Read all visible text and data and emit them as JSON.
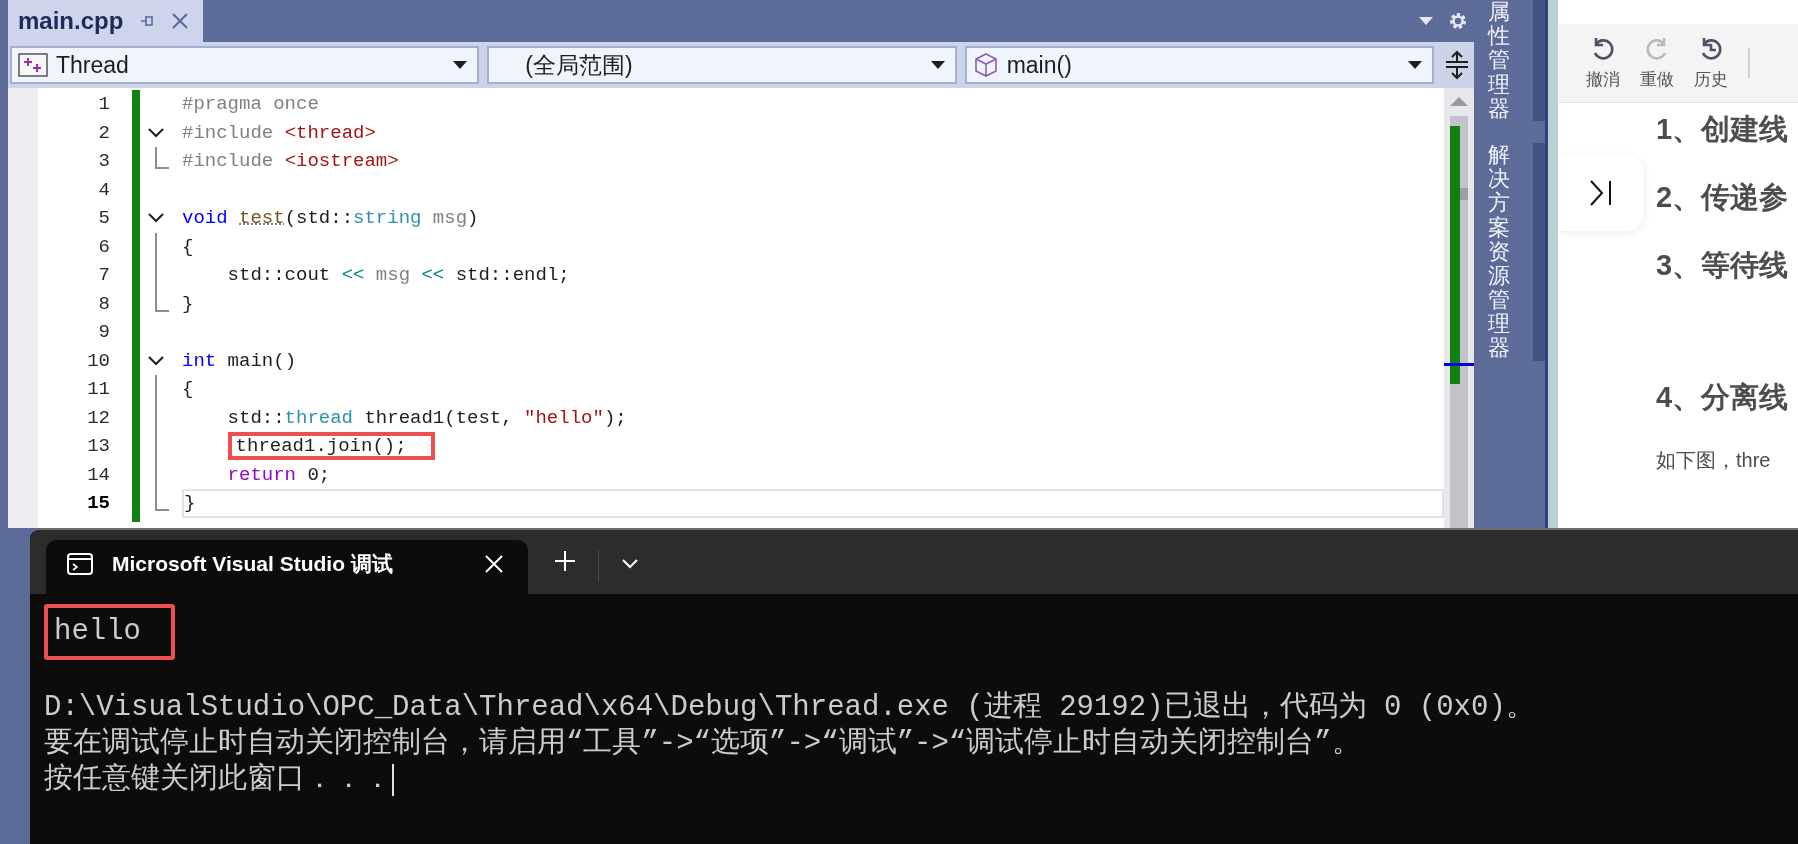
{
  "editor": {
    "tabs": [
      {
        "label": "main.cpp",
        "selected": true
      }
    ],
    "navigation": [
      {
        "kind": "project",
        "value": "Thread"
      },
      {
        "kind": "scope",
        "value": "(全局范围)"
      },
      {
        "kind": "member",
        "value": "main()"
      }
    ],
    "lines": [
      {
        "number": "1",
        "kind": "plain",
        "current": false,
        "tokens": [
          {
            "text": "#pragma once",
            "kind": "preproc"
          }
        ]
      },
      {
        "number": "2",
        "kind": "fold-start",
        "current": false,
        "tokens": [
          {
            "text": "#include ",
            "kind": "preproc"
          },
          {
            "text": "<thread>",
            "kind": "include"
          }
        ]
      },
      {
        "number": "3",
        "kind": "fold-end",
        "current": false,
        "tokens": [
          {
            "text": "#include ",
            "kind": "preproc"
          },
          {
            "text": "<iostream>",
            "kind": "include"
          }
        ]
      },
      {
        "number": "4",
        "kind": "plain",
        "current": false
      },
      {
        "number": "5",
        "kind": "fold-start",
        "current": false,
        "tokens": [
          {
            "text": "void ",
            "kind": "keyword"
          },
          {
            "text": "test",
            "kind": "func"
          },
          {
            "text": "(std::",
            "kind": "plain"
          },
          {
            "text": "string",
            "kind": "type"
          },
          {
            "text": " msg",
            "kind": "param"
          },
          {
            "text": ")",
            "kind": "plain"
          }
        ]
      },
      {
        "number": "6",
        "kind": "fold-body",
        "current": false,
        "tokens": [
          {
            "text": "{",
            "kind": "plain"
          }
        ],
        "children": [
          {
            "number": "7",
            "kind": "fold-body",
            "current": false,
            "tokens": [
              {
                "text": "std::cout ",
                "kind": "plain"
              },
              {
                "text": "<<",
                "kind": "operator"
              },
              {
                "text": " msg ",
                "kind": "param"
              },
              {
                "text": "<<",
                "kind": "operator"
              },
              {
                "text": " std::endl;",
                "kind": "plain"
              }
            ]
          }
        ]
      },
      {
        "number": "8",
        "kind": "fold-end",
        "current": false,
        "tokens": [
          {
            "text": "}",
            "kind": "plain"
          }
        ]
      },
      {
        "number": "9",
        "kind": "plain",
        "current": false
      },
      {
        "number": "10",
        "kind": "fold-start",
        "current": false,
        "tokens": [
          {
            "text": "int",
            "kind": "keyword"
          },
          {
            "text": " main()",
            "kind": "plain"
          }
        ]
      },
      {
        "number": "11",
        "kind": "fold-body",
        "current": false,
        "tokens": [
          {
            "text": "{",
            "kind": "plain"
          }
        ],
        "children": [
          {
            "number": "12",
            "kind": "fold-body",
            "current": false,
            "tokens": [
              {
                "text": "std::",
                "kind": "plain"
              },
              {
                "text": "thread",
                "kind": "type"
              },
              {
                "text": " thread1(test, ",
                "kind": "plain"
              },
              {
                "text": "\"hello\"",
                "kind": "string"
              },
              {
                "text": ");",
                "kind": "plain"
              }
            ]
          },
          {
            "number": "13",
            "kind": "fold-body",
            "current": false,
            "tokens": [
              {
                "text": "thread1.join();",
                "kind": "plain",
                "boxed": true
              }
            ]
          },
          {
            "number": "14",
            "kind": "fold-body",
            "current": false,
            "tokens": [
              {
                "text": "return",
                "kind": "control"
              },
              {
                "text": " 0;",
                "kind": "plain"
              }
            ]
          }
        ]
      },
      {
        "number": "15",
        "kind": "fold-end",
        "current": true,
        "tokens": [
          {
            "text": "}",
            "kind": "plain"
          }
        ]
      }
    ]
  },
  "side_tabs": [
    {
      "label": "属性管理器"
    },
    {
      "label": "解决方案资源管理器"
    }
  ],
  "web_panel": {
    "toolbar": [
      {
        "label": "撤消",
        "kind": "undo",
        "disabled": false
      },
      {
        "label": "重做",
        "kind": "redo",
        "disabled": true
      },
      {
        "label": "历史",
        "kind": "history",
        "disabled": false
      }
    ],
    "headings": [
      "1、创建线",
      "2、传递参",
      "3、等待线",
      "4、分离线"
    ],
    "paragraph": "如下图，thre"
  },
  "console": {
    "tab_title": "Microsoft Visual Studio 调试",
    "output": [
      {
        "text": "hello",
        "boxed": true,
        "blank_before": false,
        "cursor": false
      },
      {
        "text": "D:\\VisualStudio\\OPC_Data\\Thread\\x64\\Debug\\Thread.exe (进程 29192)已退出，代码为 0 (0x0)。",
        "boxed": false,
        "blank_before": true,
        "cursor": false
      },
      {
        "text": "要在调试停止时自动关闭控制台，请启用“工具”->“选项”->“调试”->“调试停止时自动关闭控制台”。",
        "boxed": false,
        "blank_before": false,
        "cursor": false
      },
      {
        "text": "按任意键关闭此窗口．．．",
        "boxed": false,
        "blank_before": false,
        "cursor": true
      }
    ]
  }
}
